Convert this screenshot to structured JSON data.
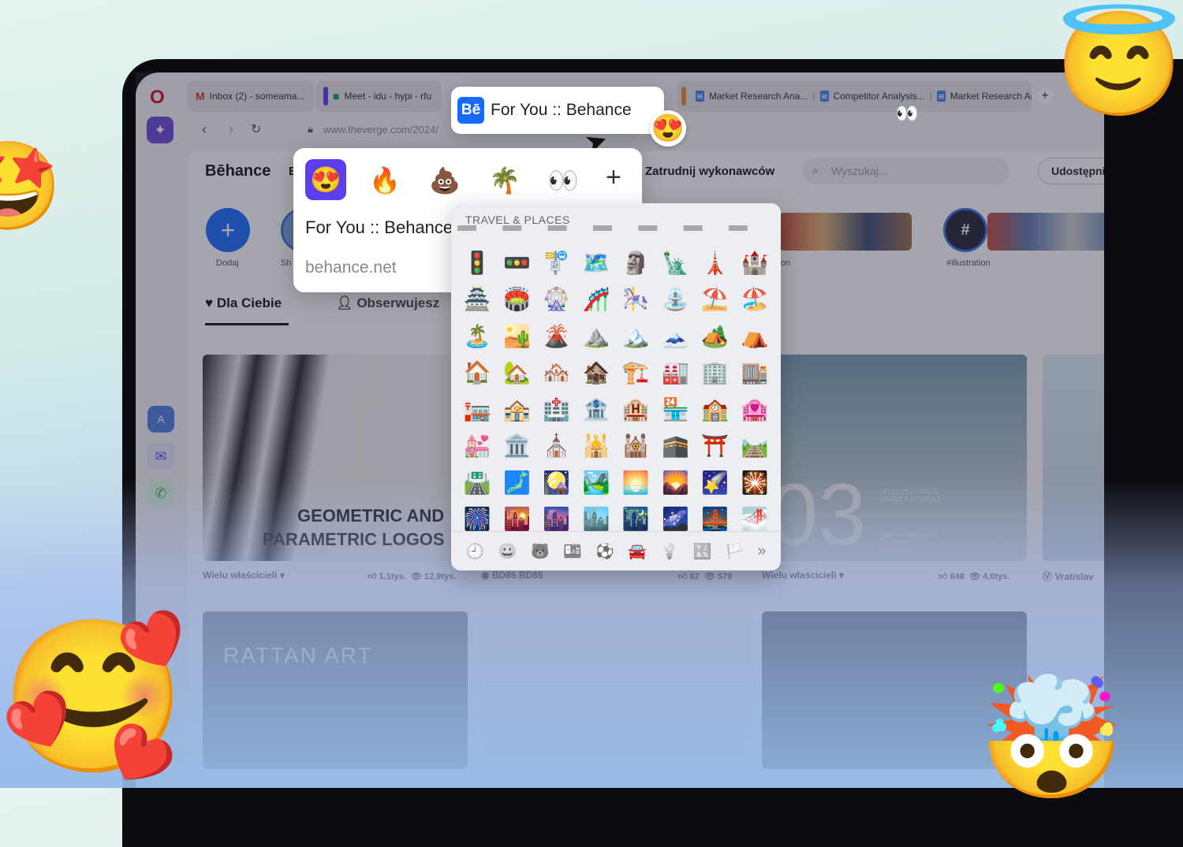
{
  "tabs": [
    {
      "label": "Inbox (2) - someama...",
      "icon": "gmail-icon"
    },
    {
      "label": "Meet - idu - hypi - rfu",
      "icon": "meet-icon"
    },
    {
      "label": "For You :: Behance",
      "icon": "behance-icon",
      "active": true
    },
    {
      "label": "Market Research Ana...",
      "icon": "docs-icon"
    },
    {
      "label": "Competitor Analysis...",
      "icon": "docs-icon"
    },
    {
      "label": "Market Research Ana...",
      "icon": "docs-icon"
    }
  ],
  "new_tab_label": "+",
  "active_tab_badge": "😍",
  "address": {
    "url": "www.theverge.com/2024/"
  },
  "behance": {
    "logo": "Bēhance",
    "nav_letter": "E",
    "hire": "Zatrudnij wykonawców",
    "search_placeholder": "Wyszukaj...",
    "share": "Udostępnij",
    "add_label": "Dodaj",
    "story_label_partial": "Sh",
    "story_label_partial2": "on",
    "hashtag": "#",
    "hashtag_label": "#illustration",
    "tab_for_you": "Dla Ciebie",
    "tab_following": "Obserwujesz",
    "card1": {
      "title_line1": "GEOMETRIC AND",
      "title_line2": "PARAMETRIC LOGOS",
      "owner": "Wielu właścicieli ▾",
      "likes": "1,1tys.",
      "views": "12,9tys."
    },
    "card2": {
      "owner": "BD85 BD85",
      "likes": "62",
      "views": "579",
      "big_text": "03",
      "small_text": "SELECTED LOGOS, MARKS & SYMBOLS",
      "small_text2": "DAM STUDIO CO © ALL RIGHTS RESERVED"
    },
    "card3": {
      "owner": "Wielu właścicieli ▾",
      "likes": "648",
      "views": "4,0tys."
    },
    "card4": {
      "owner": "Vratislav"
    },
    "card5_text": "RATTAN ART"
  },
  "popup": {
    "reactions": [
      "😍",
      "🔥",
      "💩",
      "🌴",
      "👀"
    ],
    "add": "+",
    "title": "For You :: Behance",
    "domain": "behance.net"
  },
  "emoji_panel": {
    "category_title": "TRAVEL & PLACES",
    "emojis": [
      "🚦",
      "🚥",
      "🚏",
      "🗺️",
      "🗿",
      "🗽",
      "🗼",
      "🏰",
      "🏯",
      "🏟️",
      "🎡",
      "🎢",
      "🎠",
      "⛲",
      "⛱️",
      "🏖️",
      "🏝️",
      "🏜️",
      "🌋",
      "⛰️",
      "🏔️",
      "🗻",
      "🏕️",
      "⛺",
      "🏠",
      "🏡",
      "🏘️",
      "🏚️",
      "🏗️",
      "🏭",
      "🏢",
      "🏬",
      "🏣",
      "🏤",
      "🏥",
      "🏦",
      "🏨",
      "🏪",
      "🏫",
      "🏩",
      "💒",
      "🏛️",
      "⛪",
      "🕌",
      "🕍",
      "🕋",
      "⛩️",
      "🛤️",
      "🛣️",
      "🗾",
      "🎑",
      "🏞️",
      "🌅",
      "🌄",
      "🌠",
      "🎇",
      "🎆",
      "🌇",
      "🌆",
      "🏙️",
      "🌃",
      "🌌",
      "🌉",
      "🌁"
    ],
    "categories": [
      "🕘",
      "😀",
      "🐻",
      "🍱",
      "⚽",
      "🚘",
      "💡",
      "🔣",
      "🏳️",
      "»"
    ]
  },
  "decor_emojis": {
    "halo": "😇",
    "stars": "🤩",
    "hearts": "🥰",
    "mindblown": "🤯",
    "eyes": "👀"
  }
}
